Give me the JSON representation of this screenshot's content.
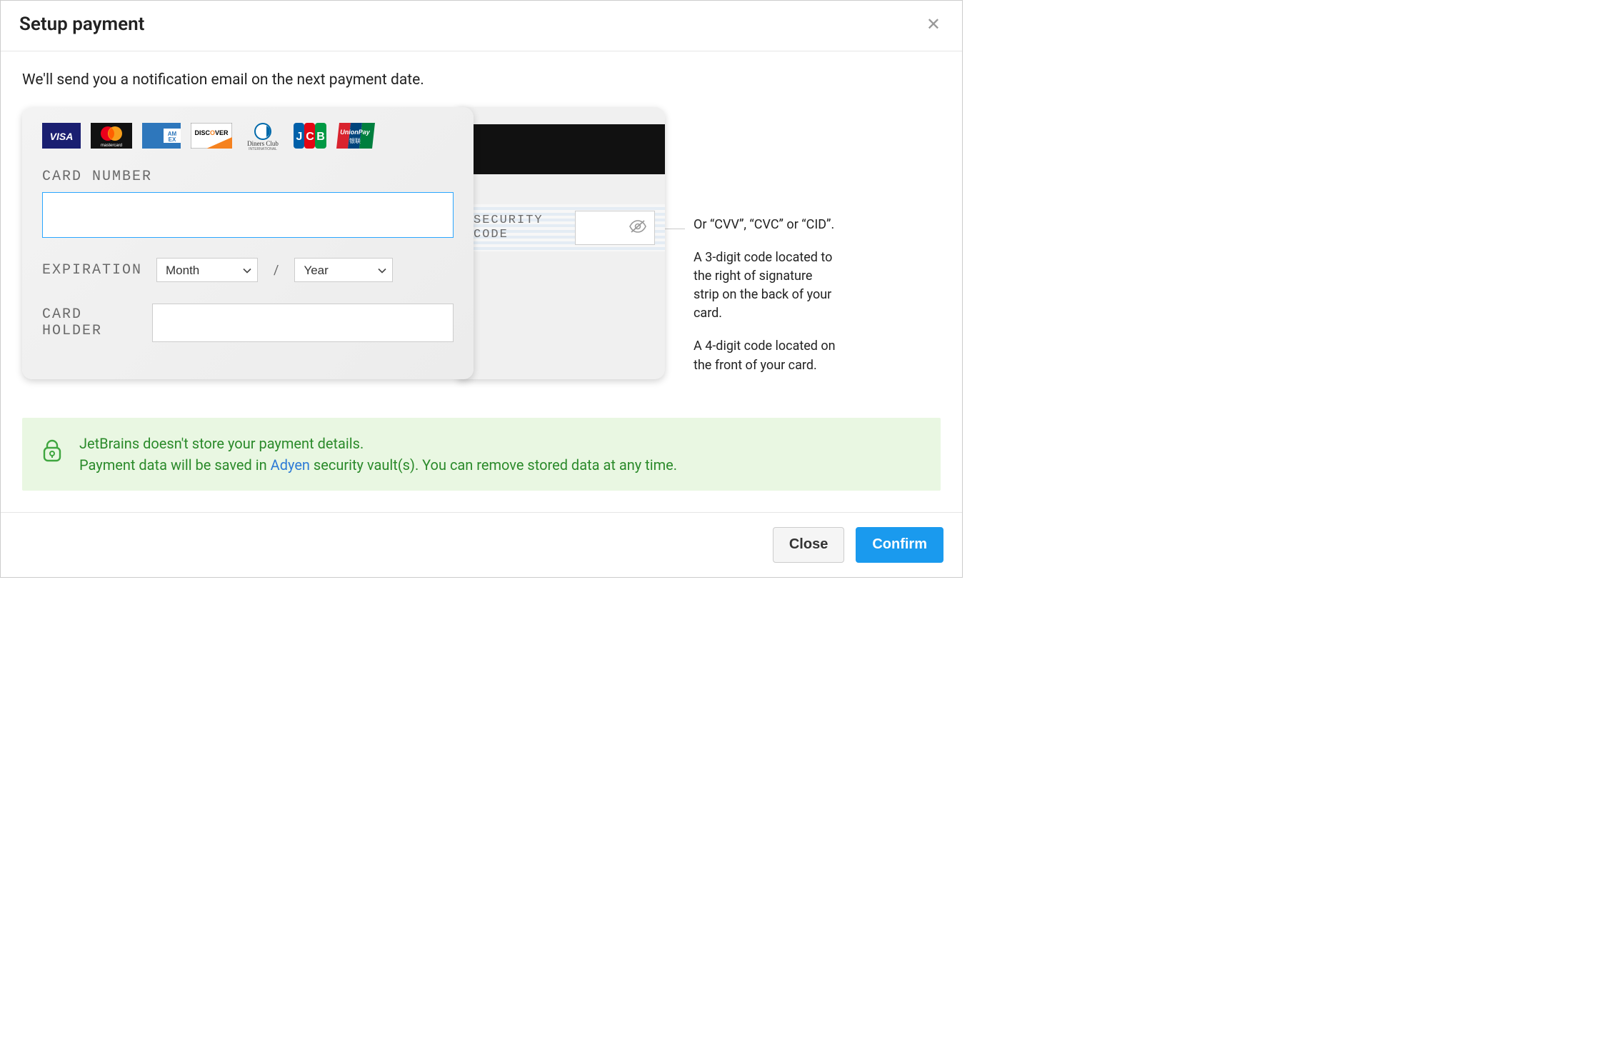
{
  "modal": {
    "title": "Setup payment",
    "intro": "We'll send you a notification email on the next payment date."
  },
  "card": {
    "number_label": "CARD NUMBER",
    "number_value": "",
    "expiration_label": "EXPIRATION",
    "month_placeholder": "Month",
    "year_placeholder": "Year",
    "holder_label": "CARD HOLDER",
    "holder_value": ""
  },
  "back": {
    "security_label_line1": "SECURITY",
    "security_label_line2": "CODE",
    "security_value": ""
  },
  "help": {
    "line1": "Or “CVV”, “CVC” or “CID”.",
    "line2": "A 3-digit code located to the right of signature strip on the back of your card.",
    "line3": "A 4-digit code located on the front of your card."
  },
  "notice": {
    "line1": "JetBrains doesn't store your payment details.",
    "line2_prefix": "Payment data will be saved in ",
    "line2_link": "Adyen",
    "line2_suffix": " security vault(s). You can remove stored data at any time."
  },
  "footer": {
    "close": "Close",
    "confirm": "Confirm"
  },
  "logos": [
    "visa",
    "mastercard",
    "amex",
    "discover",
    "diners-club",
    "jcb",
    "unionpay"
  ]
}
